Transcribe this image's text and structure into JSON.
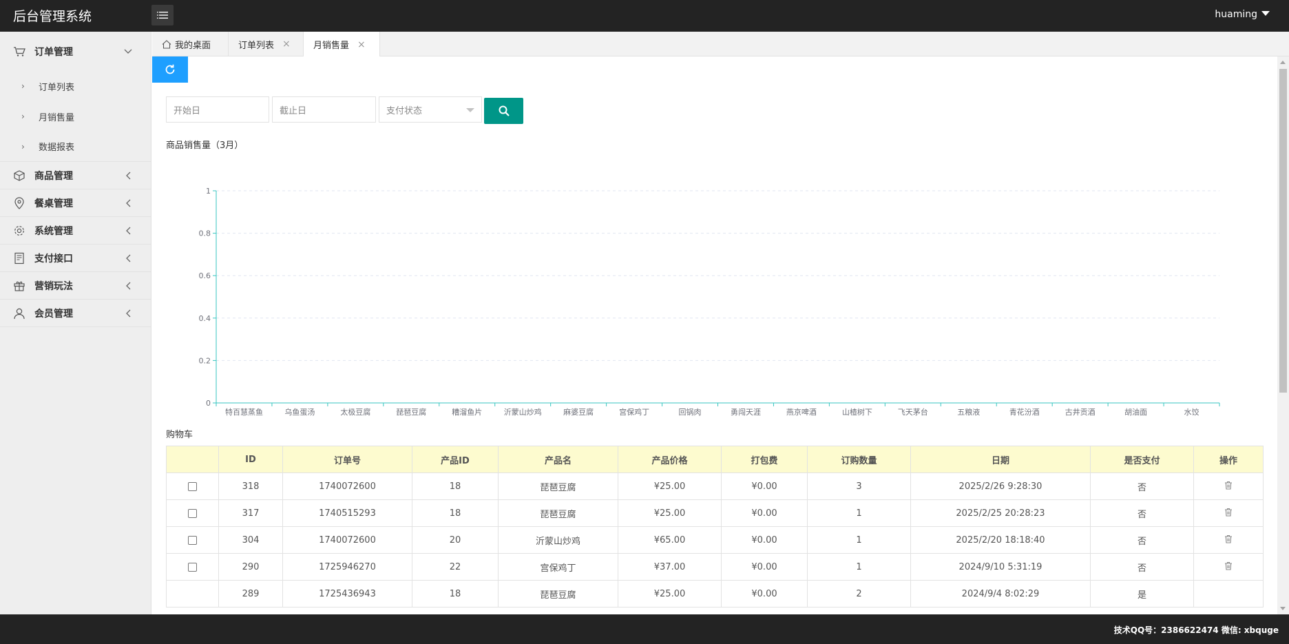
{
  "header": {
    "app_title": "后台管理系统",
    "username": "huaming"
  },
  "sidebar": {
    "groups": [
      {
        "label": "订单管理",
        "icon": "cart-icon",
        "expanded": true,
        "children": [
          {
            "label": "订单列表"
          },
          {
            "label": "月销售量"
          },
          {
            "label": "数据报表"
          }
        ]
      },
      {
        "label": "商品管理",
        "icon": "box-icon"
      },
      {
        "label": "餐桌管理",
        "icon": "location-pin-icon"
      },
      {
        "label": "系统管理",
        "icon": "gear-icon"
      },
      {
        "label": "支付接口",
        "icon": "cashier-icon"
      },
      {
        "label": "营销玩法",
        "icon": "gift-icon"
      },
      {
        "label": "会员管理",
        "icon": "user-icon"
      }
    ]
  },
  "tabs": [
    {
      "label": "我的桌面",
      "icon": "home-icon",
      "closable": false,
      "active": false
    },
    {
      "label": "订单列表",
      "closable": true,
      "active": false
    },
    {
      "label": "月销售量",
      "closable": true,
      "active": true
    }
  ],
  "filters": {
    "start_placeholder": "开始日",
    "end_placeholder": "截止日",
    "status_placeholder": "支付状态"
  },
  "colors": {
    "refresh_button": "#1E9FFF",
    "search_button": "#009688",
    "table_header": "#fdfbcf",
    "unpaid_text": "#ff0000",
    "chart_axis": "#37c6c0"
  },
  "chart_title": "商品销售量（3月）",
  "chart_data": {
    "type": "bar",
    "title": "商品销售量（3月）",
    "categories": [
      "特百慧蒸鱼",
      "乌鱼蛋汤",
      "太极豆腐",
      "琵琶豆腐",
      "糟溜鱼片",
      "沂蒙山炒鸡",
      "麻婆豆腐",
      "宫保鸡丁",
      "回锅肉",
      "勇闯天涯",
      "燕京啤酒",
      "山楂树下",
      "飞天茅台",
      "五粮液",
      "青花汾酒",
      "古井贡酒",
      "胡油面",
      "水饺"
    ],
    "values": [
      0,
      0,
      0,
      0,
      0,
      0,
      0,
      0,
      0,
      0,
      0,
      0,
      0,
      0,
      0,
      0,
      0,
      0
    ],
    "yticks": [
      "0",
      "0.2",
      "0.4",
      "0.6",
      "0.8",
      "1"
    ],
    "ylim": [
      0,
      1
    ],
    "grid": true
  },
  "cart": {
    "title": "购物车",
    "columns": [
      "",
      "ID",
      "订单号",
      "产品ID",
      "产品名",
      "产品价格",
      "打包费",
      "订购数量",
      "日期",
      "是否支付",
      "操作"
    ],
    "rows": [
      {
        "checkbox": true,
        "id": "318",
        "order_no": "1740072600",
        "product_id": "18",
        "product_name": "琵琶豆腐",
        "price": "¥25.00",
        "packing_fee": "¥0.00",
        "qty": "3",
        "date": "2025/2/26 9:28:30",
        "paid": "否",
        "delete": true
      },
      {
        "checkbox": true,
        "id": "317",
        "order_no": "1740515293",
        "product_id": "18",
        "product_name": "琵琶豆腐",
        "price": "¥25.00",
        "packing_fee": "¥0.00",
        "qty": "1",
        "date": "2025/2/25 20:28:23",
        "paid": "否",
        "delete": true
      },
      {
        "checkbox": true,
        "id": "304",
        "order_no": "1740072600",
        "product_id": "20",
        "product_name": "沂蒙山炒鸡",
        "price": "¥65.00",
        "packing_fee": "¥0.00",
        "qty": "1",
        "date": "2025/2/20 18:18:40",
        "paid": "否",
        "delete": true
      },
      {
        "checkbox": true,
        "id": "290",
        "order_no": "1725946270",
        "product_id": "22",
        "product_name": "宫保鸡丁",
        "price": "¥37.00",
        "packing_fee": "¥0.00",
        "qty": "1",
        "date": "2024/9/10 5:31:19",
        "paid": "否",
        "delete": true
      },
      {
        "checkbox": false,
        "id": "289",
        "order_no": "1725436943",
        "product_id": "18",
        "product_name": "琵琶豆腐",
        "price": "¥25.00",
        "packing_fee": "¥0.00",
        "qty": "2",
        "date": "2024/9/4 8:02:29",
        "paid": "是",
        "delete": false
      }
    ]
  },
  "footer": {
    "text": "技术QQ号：2386622474 微信: xbquge"
  }
}
